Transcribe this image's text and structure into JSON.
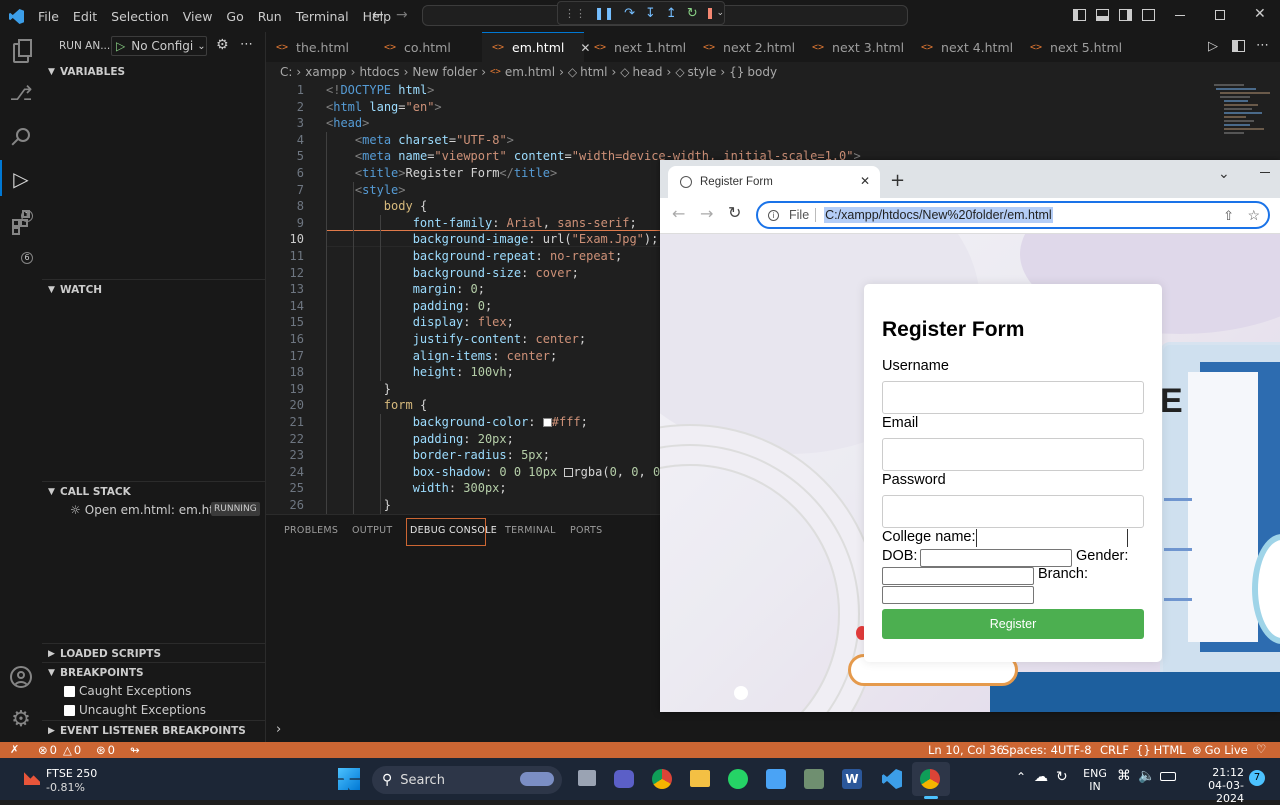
{
  "titlebar": {
    "menu": [
      "File",
      "Edit",
      "Selection",
      "View",
      "Go",
      "Run",
      "Terminal",
      "Help"
    ]
  },
  "debug_toolbar": {
    "icons": [
      "grip-icon",
      "pause-icon",
      "step-over-icon",
      "step-into-icon",
      "step-out-icon",
      "restart-icon",
      "stop-icon"
    ]
  },
  "sidebar": {
    "run_label": "RUN AN...",
    "config": "No Configi",
    "variables": "VARIABLES",
    "watch": "WATCH",
    "call_stack": "CALL STACK",
    "call_stack_item": "Open em.html: em.ht...",
    "call_stack_badge": "RUNNING",
    "loaded_scripts": "LOADED SCRIPTS",
    "breakpoints": "BREAKPOINTS",
    "caught": "Caught Exceptions",
    "uncaught": "Uncaught Exceptions",
    "event_listener": "EVENT LISTENER BREAKPOINTS"
  },
  "activity_badges": {
    "debug": "1",
    "extensions": "6"
  },
  "tabs": [
    "the.html",
    "co.html",
    "em.html",
    "next 1.html",
    "next 2.html",
    "next 3.html",
    "next 4.html",
    "next 5.html"
  ],
  "active_tab": "em.html",
  "breadcrumb": {
    "drive": "C:",
    "p1": "xampp",
    "p2": "htdocs",
    "p3": "New folder",
    "file": "em.html",
    "e1": "html",
    "e2": "head",
    "e3": "style",
    "e4": "body"
  },
  "line_numbers": [
    "1",
    "2",
    "3",
    "4",
    "5",
    "6",
    "7",
    "8",
    "9",
    "10",
    "11",
    "12",
    "13",
    "14",
    "15",
    "16",
    "17",
    "18",
    "19",
    "20",
    "21",
    "22",
    "23",
    "24",
    "25",
    "26"
  ],
  "panel_tabs": [
    "PROBLEMS",
    "OUTPUT",
    "DEBUG CONSOLE",
    "TERMINAL",
    "PORTS"
  ],
  "statusbar": {
    "errors": "0",
    "warnings": "0",
    "ports": "0",
    "position": "Ln 10, Col 36",
    "spaces": "Spaces: 4",
    "encoding": "UTF-8",
    "eol": "CRLF",
    "language": "HTML",
    "golive": "Go Live"
  },
  "browser": {
    "tab_title": "Register Form",
    "scheme": "File",
    "url": "C:/xampp/htdocs/New%20folder/em.html"
  },
  "form": {
    "title": "Register Form",
    "username": "Username",
    "email": "Email",
    "password": "Password",
    "college": "College name:",
    "dob": "DOB:",
    "gender": "Gender:",
    "branch": "Branch:",
    "submit": "Register"
  },
  "page_art": {
    "letter_e": "E"
  },
  "taskbar": {
    "stock_name": "FTSE 250",
    "stock_change": "-0.81%",
    "search": "Search",
    "lang1": "ENG",
    "lang2": "IN",
    "time": "21:12",
    "date": "04-03-2024",
    "notif_count": "7"
  }
}
